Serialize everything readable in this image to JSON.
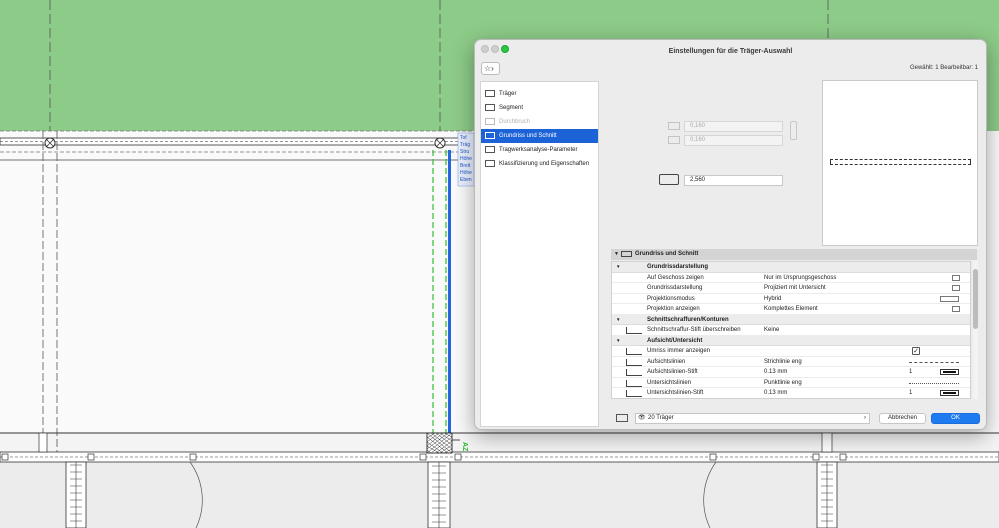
{
  "dialog": {
    "title": "Einstellungen für die Träger-Auswahl",
    "favorites_label": "☆›",
    "selection_info": "Gewählt: 1 Bearbeitbar: 1"
  },
  "nav": {
    "items": [
      {
        "label": "Träger",
        "state": "normal"
      },
      {
        "label": "Segment",
        "state": "normal"
      },
      {
        "label": "Durchbruch",
        "state": "disabled"
      },
      {
        "label": "Grundriss und Schnitt",
        "state": "active"
      },
      {
        "label": "Tragwerksanalyse-Parameter",
        "state": "normal"
      },
      {
        "label": "Klassifizierung und Eigenschaften",
        "state": "normal"
      }
    ]
  },
  "dimensions": {
    "width": "0,160",
    "height": "0,160",
    "length": "2,560"
  },
  "section": {
    "title": "Grundriss und Schnitt",
    "groups": [
      {
        "title": "Grundrissdarstellung",
        "rows": [
          {
            "label": "Auf Geschoss zeigen",
            "value": "Nur im Ursprungsgeschoss",
            "num": ""
          },
          {
            "label": "Grundrissdarstellung",
            "value": "Projiziert mit Untersicht",
            "num": ""
          },
          {
            "label": "Projektionsmodus",
            "value": "Hybrid",
            "num": ""
          },
          {
            "label": "Projektion anzeigen",
            "value": "Komplettes Element",
            "num": ""
          }
        ]
      },
      {
        "title": "Schnittschraffuren/Konturen",
        "rows": [
          {
            "label": "Schnittschraffur-Stift überschreiben",
            "value": "Keine",
            "num": ""
          }
        ]
      },
      {
        "title": "Aufsicht/Untersicht",
        "rows": [
          {
            "label": "Umriss immer anzeigen",
            "value": "",
            "num": ""
          },
          {
            "label": "Aufsichtslinien",
            "value": "Strichlinie eng",
            "num": ""
          },
          {
            "label": "Aufsichtslinien-Stift",
            "value": "0.13 mm",
            "num": "1"
          },
          {
            "label": "Untersichtslinien",
            "value": "Punktlinie eng",
            "num": ""
          },
          {
            "label": "Untersichtslinien-Stift",
            "value": "0.13 mm",
            "num": "1"
          }
        ]
      }
    ]
  },
  "footer": {
    "layer": "20 Träger",
    "cancel": "Abbrechen",
    "ok": "OK"
  },
  "canvas": {
    "tooltip_lines": [
      "Tof",
      "Träg",
      "Stru",
      "Höhe",
      "Breit",
      "Höhe",
      "Eben"
    ],
    "marker_label": "AZ"
  },
  "colors": {
    "canvas_green": "#8dcb88",
    "selection_blue": "#1d63d8",
    "ok_blue": "#1f7bf0",
    "selected_beam_green": "#2ec12b"
  }
}
